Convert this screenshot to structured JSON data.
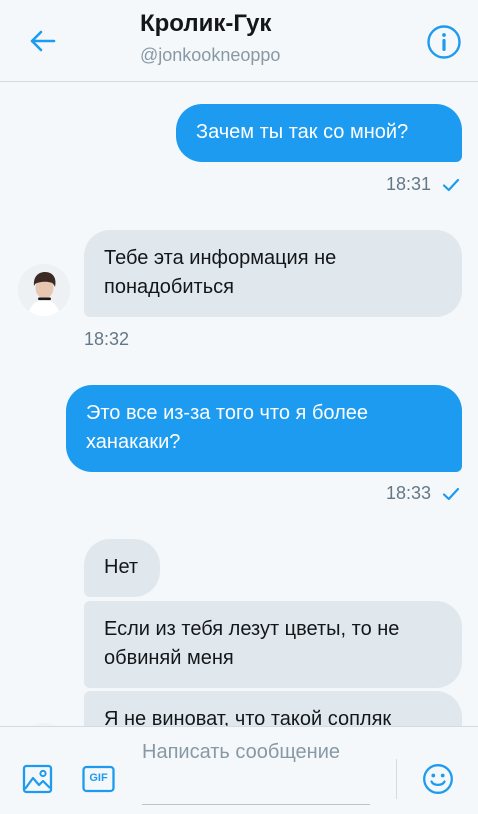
{
  "header": {
    "name": "Кролик-Гук",
    "handle": "@jonkookneoppo",
    "back_icon": "arrow-left-icon",
    "info_icon": "info-circle-icon"
  },
  "messages": [
    {
      "direction": "outgoing",
      "text": "Зачем ты так со мной?",
      "time": "18:31",
      "read": true
    },
    {
      "direction": "incoming",
      "text": "Тебе эта информация не понадобиться",
      "time": "18:32"
    },
    {
      "direction": "outgoing",
      "text": "Это все из-за того что я более ханакаки?",
      "time": "18:33",
      "read": true
    },
    {
      "direction": "incoming",
      "text": "Нет"
    },
    {
      "direction": "incoming",
      "text": "Если из тебя лезут цветы, то не обвиняй меня"
    },
    {
      "direction": "incoming",
      "text": "Я не виноват, что такой сопляк"
    }
  ],
  "composer": {
    "placeholder": "Написать сообщение",
    "image_icon": "image-icon",
    "gif_icon": "gif-icon",
    "gif_label": "GIF",
    "emoji_icon": "emoji-icon"
  },
  "colors": {
    "accent": "#1d9bf0",
    "incoming_bubble": "#e1e8ed",
    "background": "#f5f8fa",
    "muted_text": "#657786"
  }
}
